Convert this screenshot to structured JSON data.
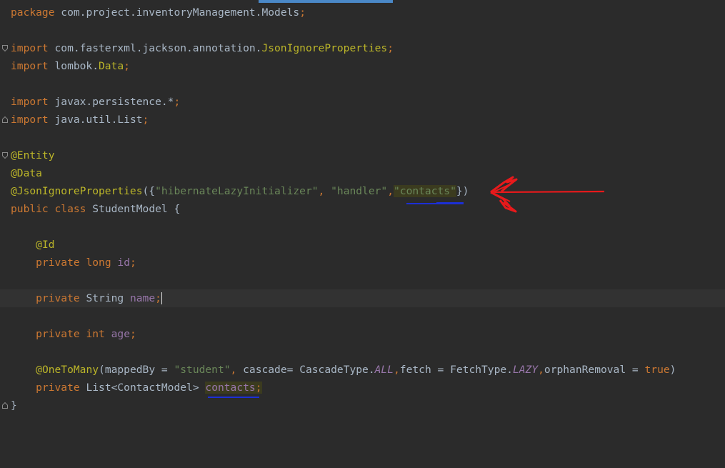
{
  "code": {
    "l1": {
      "kw": "package",
      "rest": " com.project.inventoryManagement.Models",
      "semi": ";"
    },
    "l3": {
      "kw": "import",
      "pkg": " com.fasterxml.jackson.annotation.",
      "cls": "JsonIgnoreProperties",
      "semi": ";"
    },
    "l4": {
      "kw": "import",
      "pkg": " lombok.",
      "cls": "Data",
      "semi": ";"
    },
    "l6": {
      "kw": "import",
      "pkg": " javax.persistence.*",
      "semi": ";"
    },
    "l7": {
      "kw": "import",
      "pkg": " java.util.List",
      "semi": ";"
    },
    "l9": {
      "ann": "@Entity"
    },
    "l10": {
      "ann": "@Data"
    },
    "l11": {
      "ann": "@JsonIgnoreProperties",
      "p1": "({",
      "s1": "\"hibernateLazyInitializer\"",
      "c1": ", ",
      "s2": "\"handler\"",
      "c2": ",",
      "s3": "\"contacts\"",
      "p2": "})"
    },
    "l12": {
      "kw1": "public",
      "kw2": "class",
      "name": "StudentModel",
      "brace": " {"
    },
    "l14": {
      "ann": "@Id"
    },
    "l15": {
      "kw1": "private",
      "kw2": "long",
      "fld": "id",
      "semi": ";"
    },
    "l17": {
      "kw": "private",
      "type": " String ",
      "fld": "name",
      "semi": ";"
    },
    "l19": {
      "kw1": "private",
      "kw2": "int",
      "fld": "age",
      "semi": ";"
    },
    "l21": {
      "ann": "@OneToMany",
      "p1": "(mappedBy = ",
      "s1": "\"student\"",
      "c1": ", ",
      "p2": "cascade= CascadeType.",
      "e1": "ALL",
      "c2": ",",
      "p3": "fetch = FetchType.",
      "e2": "LAZY",
      "c3": ",",
      "p4": "orphanRemoval = ",
      "kwt": "true",
      "p5": ")"
    },
    "l22": {
      "kw": "private",
      "type": " List<ContactModel> ",
      "fld": "contacts",
      "semi": ";"
    },
    "l23": {
      "brace": "}"
    }
  }
}
